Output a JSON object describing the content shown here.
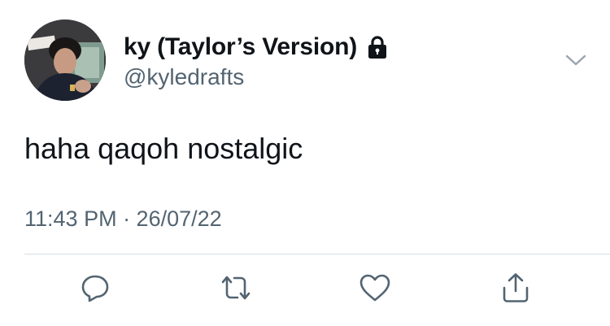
{
  "author": {
    "display_name": "ky (Taylor’s Version)",
    "handle": "@kyledrafts",
    "protected": true,
    "lock_icon": "lock-icon",
    "avatar_icon": "avatar-photo"
  },
  "tweet": {
    "text": "haha qaqoh nostalgic",
    "timestamp": "11:43 PM · 26/07/22"
  },
  "menu": {
    "icon": "chevron-down-icon"
  },
  "actions": [
    {
      "name": "reply",
      "icon": "reply-icon"
    },
    {
      "name": "retweet",
      "icon": "retweet-icon"
    },
    {
      "name": "like",
      "icon": "heart-icon"
    },
    {
      "name": "share",
      "icon": "share-icon"
    }
  ],
  "colors": {
    "text_primary": "#0f1419",
    "text_secondary": "#536471",
    "divider": "#d8dde1",
    "icon": "#536471"
  }
}
